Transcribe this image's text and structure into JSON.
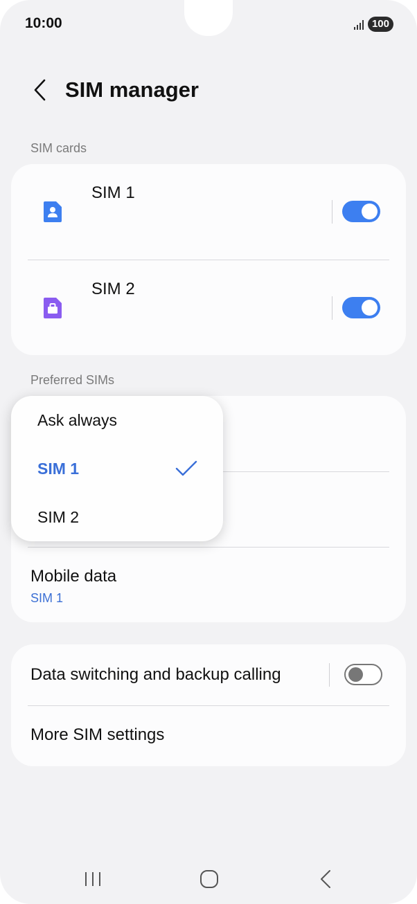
{
  "status_bar": {
    "time": "10:00",
    "battery": "100"
  },
  "header": {
    "title": "SIM manager"
  },
  "sim_cards": {
    "section_label": "SIM cards",
    "items": [
      {
        "name": "SIM 1",
        "icon": "sim-person-icon",
        "color": "#3d7ff0",
        "enabled": true
      },
      {
        "name": "SIM 2",
        "icon": "sim-briefcase-icon",
        "color": "#8a5cf0",
        "enabled": true
      }
    ]
  },
  "preferred": {
    "section_label": "Preferred SIMs",
    "mobile_data": {
      "title": "Mobile data",
      "value": "SIM 1"
    }
  },
  "popup": {
    "options": [
      "Ask always",
      "SIM 1",
      "SIM 2"
    ],
    "selected": "SIM 1"
  },
  "extra": {
    "data_switching_label": "Data switching and backup calling",
    "data_switching_enabled": false,
    "more_settings_label": "More SIM settings"
  },
  "colors": {
    "accent": "#3d7ff0",
    "background": "#f2f2f4"
  }
}
